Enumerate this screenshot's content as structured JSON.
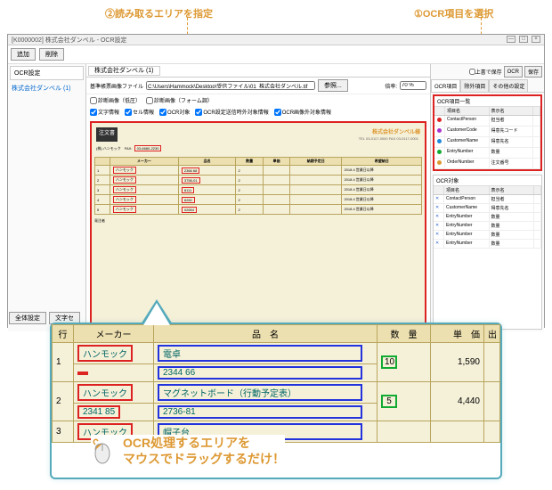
{
  "annotations": {
    "a1": "①OCR項目を選択",
    "a2": "②読み取るエリアを指定"
  },
  "window": {
    "title": "[K0000002] 株式会社ダンベル - OCR設定",
    "minimize": "—",
    "maximize": "□",
    "close": "×"
  },
  "topButtons": {
    "add": "追加",
    "delete": "削除"
  },
  "leftPanel": {
    "tab": "OCR設定",
    "item": "株式会社ダンベル (1)"
  },
  "centerTab": "株式会社ダンベル (1)",
  "toolbar": {
    "label": "基準帳票画像ファイル",
    "filepath": "C:\\Users\\Hammock\\Desktop\\受信ファイル\\01_株式会社ダンベル.tif",
    "browse": "参照...",
    "zoomLabel": "倍率:",
    "zoomValue": "70 %"
  },
  "checkboxes": {
    "c1": "診断画像（低圧）",
    "c2": "診断画像（フォーム調）",
    "c3": "文字情報",
    "c4": "セル情報",
    "c5": "OCR対象",
    "c6": "OCR設定送信時外対象情報",
    "c7": "OCR画像外対象情報"
  },
  "faxDoc": {
    "titleBox": "注文書",
    "company": "株式会社ダンベル様",
    "tel": "TEL 03-0117-0000  FAX 03-0117-0001",
    "to": "(株) ハンモック　FAX: ",
    "fax": "03-6680-2230",
    "tableHeaders": {
      "row": "",
      "maker": "メーカー",
      "name": "品名",
      "qty": "数量",
      "unit": "単価",
      "date1": "納期予定日",
      "date2": "希望納日"
    },
    "rows": [
      {
        "maker": "ハンモック",
        "name": "2366 68",
        "qty": "2",
        "date": "2018.4 営業日以降"
      },
      {
        "maker": "ハンモック",
        "name": "3758-01",
        "qty": "2",
        "date": "2018.4 営業日以降"
      },
      {
        "maker": "ハンモック",
        "name": "8111",
        "qty": "2",
        "date": "2018.4 営業日以降"
      },
      {
        "maker": "ハンモック",
        "name": "6260",
        "qty": "2",
        "date": "2018.4 営業日以降"
      },
      {
        "maker": "ハンモック",
        "name": "02654",
        "qty": "2",
        "date": "2018.4 営業日以降"
      }
    ],
    "sender": "発注者"
  },
  "rightPanel": {
    "topCheck": "上書で保存",
    "btnOCR": "OCR",
    "btnSave": "保存",
    "tabs": {
      "t1": "OCR項目",
      "t2": "除外項目",
      "t3": "その他の設定"
    },
    "listTitle": "OCR項目一覧",
    "gridHeaders": {
      "col1": "",
      "col2": "項目名",
      "col3": "表示名",
      "col4": ""
    },
    "items": [
      {
        "color": "#d22",
        "name": "ContactPerson",
        "display": "担当者"
      },
      {
        "color": "#a3c",
        "name": "CustomerCode",
        "display": "得意先コード"
      },
      {
        "color": "#28d",
        "name": "CustomerName",
        "display": "得意先名"
      },
      {
        "color": "#1a3",
        "name": "EntryNumber",
        "display": "数量"
      },
      {
        "color": "#d93",
        "name": "OrderNumber",
        "display": "注文番号"
      }
    ],
    "targetTitle": "OCR対象",
    "targetHeaders": {
      "col1": "",
      "col2": "項目名",
      "col3": "表示名",
      "col4": ""
    },
    "targets": [
      {
        "name": "ContactPerson",
        "display": "担当者"
      },
      {
        "name": "CustomerName",
        "display": "得意先名"
      },
      {
        "name": "EntryNumber",
        "display": "数量"
      },
      {
        "name": "EntryNumber",
        "display": "数量"
      },
      {
        "name": "EntryNumber",
        "display": "数量"
      },
      {
        "name": "EntryNumber",
        "display": "数量"
      }
    ]
  },
  "bottomButtons": {
    "b1": "全体設定",
    "b2": "文字セ"
  },
  "zoom": {
    "headers": {
      "row": "行",
      "maker": "メーカー",
      "name": "品　名",
      "qty": "数　量",
      "price": "単　価",
      "ext": "出"
    },
    "rows": [
      {
        "n": "1",
        "maker": "ハンモック",
        "code1": "",
        "name1": "電卓",
        "code2": "2344 66",
        "qty": "10",
        "price": "1,590"
      },
      {
        "n": "2",
        "maker": "ハンモック",
        "code1": "2341 85",
        "name1": "マグネットボード（行動予定表）",
        "code2": "2736-81",
        "qty": "5",
        "price": "4,440"
      },
      {
        "n": "3",
        "maker": "ハンモック",
        "name1": "帽子台"
      }
    ],
    "captionLine1": "OCR処理するエリアを",
    "captionLine2": "マウスでドラッグするだけ！"
  }
}
